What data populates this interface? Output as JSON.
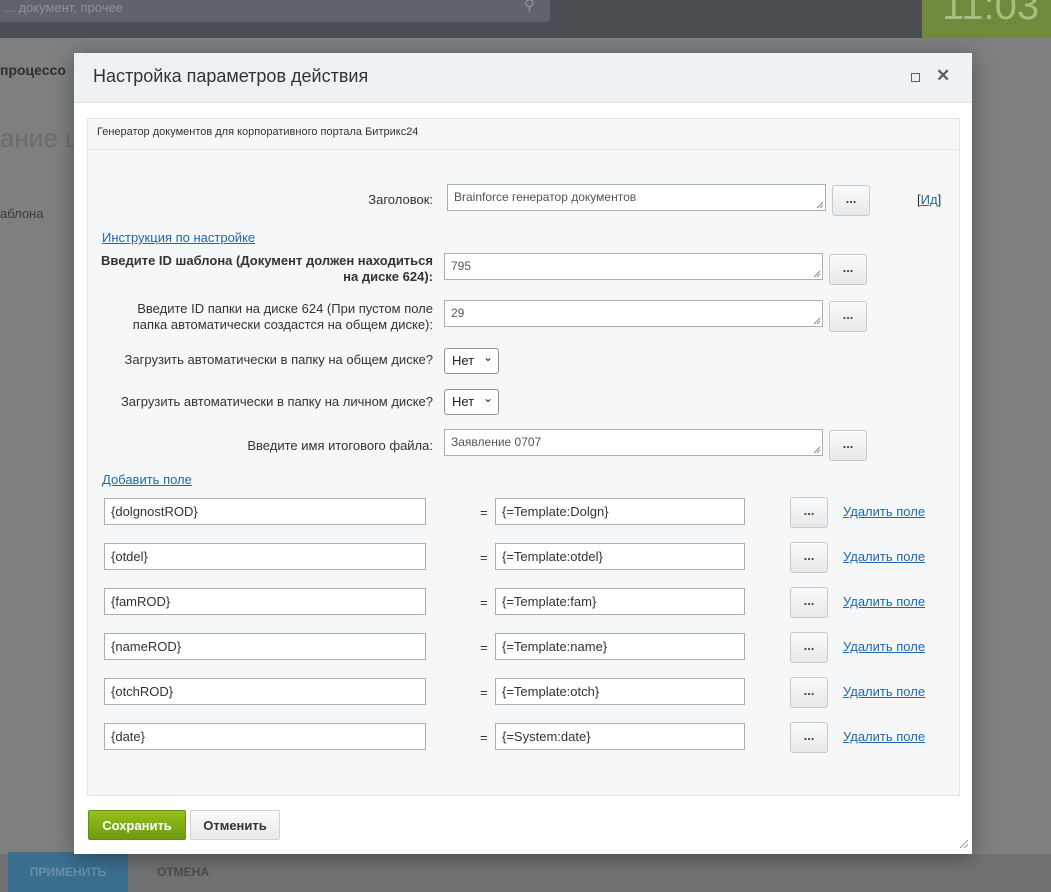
{
  "background": {
    "search_placeholder": "... документ, прочее",
    "clock": "11:03",
    "breadcrumb": "процессо",
    "page_heading": "ание ш",
    "tab_label": "аблона",
    "apply_label": "ПРИМЕНИТЬ",
    "cancel_label": "ОТМЕНА"
  },
  "dialog": {
    "title": "Настройка параметров действия",
    "panel_title": "Генератор документов для корпоративного портала Битрикс24",
    "title_field": {
      "label": "Заголовок:",
      "value": "Brainforce генератор документов",
      "id_link_open": "[",
      "id_link": "Ид",
      "id_link_close": "]"
    },
    "instruction_link": "Инструкция по настройке",
    "template_id": {
      "label_line1": "Введите ID шаблона (Документ должен находиться",
      "label_line2": "на диске 624):",
      "value": "795"
    },
    "folder_id": {
      "label_line1": "Введите ID папки на диске 624 (При пустом поле",
      "label_line2": "папка автоматически создастся на общем диске):",
      "value": "29"
    },
    "upload_common": {
      "label": "Загрузить автоматически в папку на общем диске?",
      "value": "Нет"
    },
    "upload_personal": {
      "label": "Загрузить автоматически в папку на личном диске?",
      "value": "Нет"
    },
    "file_name": {
      "label": "Введите имя итогового файла:",
      "value": "Заявление 0707"
    },
    "add_field_link": "Добавить поле",
    "dots_label": "...",
    "equals": "=",
    "delete_label": "Удалить поле",
    "mappings": [
      {
        "key": "{dolgnostROD}",
        "value": "{=Template:Dolgn}"
      },
      {
        "key": "{otdel}",
        "value": "{=Template:otdel}"
      },
      {
        "key": "{famROD}",
        "value": "{=Template:fam}"
      },
      {
        "key": "{nameROD}",
        "value": "{=Template:name}"
      },
      {
        "key": "{otchROD}",
        "value": "{=Template:otch}"
      },
      {
        "key": "{date}",
        "value": "{=System:date}"
      }
    ],
    "save_label": "Сохранить",
    "cancel_label": "Отменить"
  },
  "colors": {
    "save_button": "#80ab17",
    "link": "#2067b0",
    "header_bg": "#eef2f4"
  },
  "icons": [
    "search-icon",
    "maximize-icon",
    "close-icon",
    "select-chevron-icon",
    "resize-grip-icon"
  ]
}
